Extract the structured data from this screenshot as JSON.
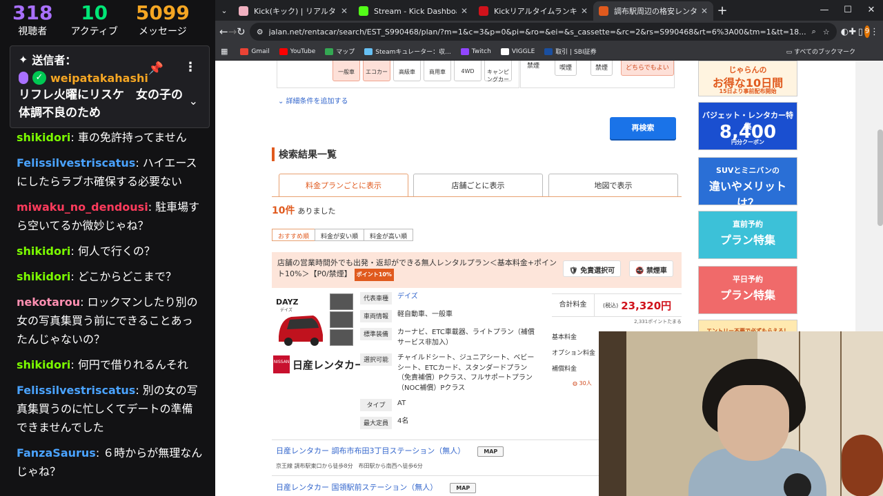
{
  "chat": {
    "stats": [
      {
        "value": "318",
        "label": "視聴者",
        "color": "#a970ff"
      },
      {
        "value": "10",
        "label": "アクティブ",
        "color": "#00e676"
      },
      {
        "value": "5099",
        "label": "メッセージ",
        "color": "#f5a623"
      }
    ],
    "pinned": {
      "header": "送信者：",
      "user": "weipatakahashi",
      "text": "リフレ火曜にリスケ　女の子の体調不良のため"
    },
    "messages": [
      {
        "user": "shikidori",
        "color": "#7cfc00",
        "text": "車の免許持ってません"
      },
      {
        "user": "Felissilvestriscatus",
        "color": "#4aa3ff",
        "text": "ハイエースにしたらラブホ確保する必要ない"
      },
      {
        "user": "miwaku_no_dendousi",
        "color": "#ff3b5c",
        "text": "駐車場すら空いてるか微妙じゃね？"
      },
      {
        "user": "shikidori",
        "color": "#7cfc00",
        "text": "何人で行くの？"
      },
      {
        "user": "shikidori",
        "color": "#7cfc00",
        "text": "どこからどこまで？"
      },
      {
        "user": "nekotarou",
        "color": "#ff8fb1",
        "text": "ロックマンしたり別の女の写真集買う前にできることあったんじゃないの？"
      },
      {
        "user": "shikidori",
        "color": "#7cfc00",
        "text": "何円で借りれるんそれ"
      },
      {
        "user": "Felissilvestriscatus",
        "color": "#4aa3ff",
        "text": "別の女の写真集買うのに忙しくてデートの準備できませんでした"
      },
      {
        "user": "FanzaSaurus",
        "color": "#4aa3ff",
        "text": "６時からが無理なんじゃね？"
      }
    ]
  },
  "browser": {
    "tabs": [
      {
        "title": "Kick(キック) | リアルタイムランキング",
        "favcolor": "#f0b0c0"
      },
      {
        "title": "Stream - Kick Dashboard",
        "favcolor": "#53fc18"
      },
      {
        "title": "Kickリアルタイムランキング | 配信者",
        "favcolor": "#d0121b"
      },
      {
        "title": "調布駅周辺の格安レンタカーを探し",
        "favcolor": "#e05a1e"
      }
    ],
    "url": "jalan.net/rentacar/search/EST_S990468/plan/?m=1&c=3&p=0&pi=&ro=&ei=&s_cassette=&rc=2&rs=S990468&rt=6%3A00&tm=1&tt=18...",
    "profile_initial": "9",
    "bookmarks": [
      {
        "label": "Gmail",
        "color": "#ea4335"
      },
      {
        "label": "YouTube",
        "color": "#ff0000"
      },
      {
        "label": "マップ",
        "color": "#34a853"
      },
      {
        "label": "Steamキュレーター：収...",
        "color": "#66c0f4"
      },
      {
        "label": "Twitch",
        "color": "#9146ff"
      },
      {
        "label": "VIGGLE",
        "color": "#ffffff"
      },
      {
        "label": "取引 | SBI証券",
        "color": "#1a4fa0"
      }
    ],
    "bookmarks_all": "すべてのブックマーク"
  },
  "page": {
    "car_types": [
      "一般車",
      "エコカー",
      "高級車",
      "商用車",
      "4WD",
      "キャンピングカー"
    ],
    "smoke_label": "禁煙",
    "smoke_opts": [
      "喫煙",
      "禁煙",
      "どちらでもよい"
    ],
    "add_conditions": "詳細条件を追加する",
    "research": "再検索",
    "results_title": "検索結果一覧",
    "view_tabs": [
      "料金プランごとに表示",
      "店舗ごとに表示",
      "地図で表示"
    ],
    "count": "10件",
    "count_suffix": "ありました",
    "sorts": [
      "おすすめ順",
      "料金が安い順",
      "料金が高い順"
    ],
    "plan_text": "店舗の営業時間外でも出発・返却ができる無人レンタルプラン＜基本料金+ポイント10%＞【P0/禁煙】",
    "plan_badge": "ポイント10%",
    "plan_opts": [
      "免責選択可",
      "禁煙車"
    ],
    "car_label": "DAYZ",
    "car_sub": "デイズ",
    "company": "日産レンタカー",
    "specs": [
      {
        "k": "代表車種",
        "v": "デイズ",
        "link": true
      },
      {
        "k": "車両情報",
        "v": "軽自動車、一般車"
      },
      {
        "k": "標準装備",
        "v": "カーナビ、ETC車載器、ライトプラン（補償サービス非加入）"
      },
      {
        "k": "選択可能",
        "v": "チャイルドシート、ジュニアシート、ベビーシート、ETCカード、スタンダードプラン（免責補償）Pクラス、フルサポートプラン（NOC補償）Pクラス"
      },
      {
        "k": "タイプ",
        "v": "AT"
      },
      {
        "k": "最大定員",
        "v": "4名"
      }
    ],
    "total_label": "合計料金",
    "tax": "(税込)",
    "price": "23,320円",
    "points": "2,331ポイントたまる",
    "price_lines": [
      "基本料金",
      "オプション料金",
      "補償料金"
    ],
    "reviews": "30人",
    "stations": [
      {
        "name": "日産レンタカー 調布市布田3丁目ステーション（無人）",
        "sub": "京王線 調布駅東口から徒歩8分　布田駅から南西へ徒歩6分"
      },
      {
        "name": "日産レンタカー 国領駅前ステーション（無人）",
        "sub": ""
      }
    ],
    "map_label": "MAP",
    "ads": [
      {
        "line1": "じゃらんの",
        "line2": "お得な10日間",
        "sub": "15日より事前配布開始",
        "bg": "#fff4e0",
        "fg": "#e05a1e"
      },
      {
        "line1": "バジェット・レンタカー特集",
        "line2": "8,400",
        "sub": "円分クーポン",
        "bg": "#1a4fd0",
        "fg": "#ffffff"
      },
      {
        "line1": "SUVとミニバンの",
        "line2": "違いやメリットは？",
        "sub": "",
        "bg": "#2a6fd6",
        "fg": "#ffffff"
      },
      {
        "line1": "直前予約",
        "line2": "プラン特集",
        "sub": "",
        "bg": "#3cc1d8",
        "fg": "#ffffff"
      },
      {
        "line1": "平日予約",
        "line2": "プラン特集",
        "sub": "",
        "bg": "#f06a6a",
        "fg": "#ffffff"
      },
      {
        "line1": "エントリー不要で必ずもらえる！",
        "line2": "",
        "sub": "",
        "bg": "#ffe9b0",
        "fg": "#c04a10"
      }
    ]
  }
}
